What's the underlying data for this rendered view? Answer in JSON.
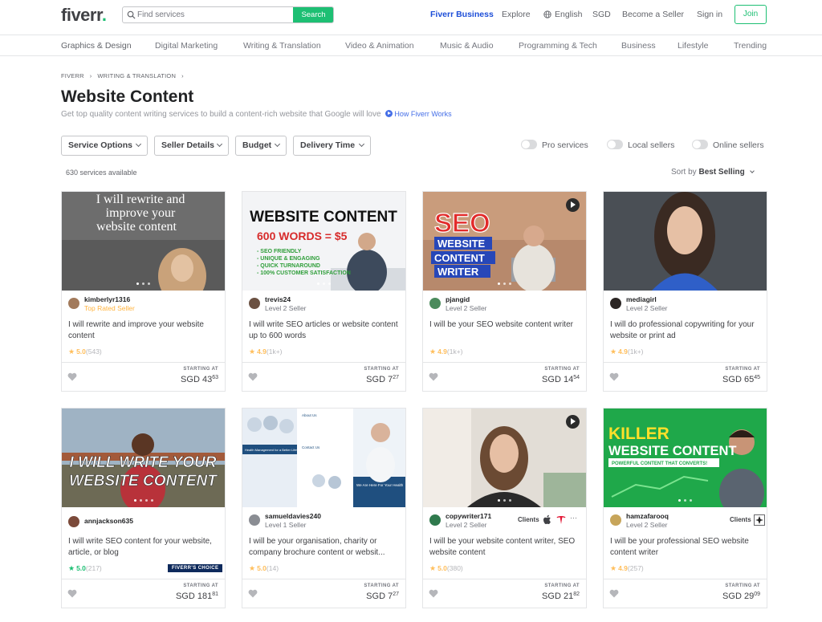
{
  "header": {
    "logo": "fiverr",
    "logo_dot": ".",
    "search_placeholder": "Find services",
    "search_button": "Search",
    "nav": {
      "fiverr_business": "Fiverr Business",
      "explore": "Explore",
      "language": "English",
      "currency": "SGD",
      "become_seller": "Become a Seller",
      "sign_in": "Sign in",
      "join": "Join"
    },
    "brand_color": "#1dbf73"
  },
  "categories": [
    "Graphics & Design",
    "Digital Marketing",
    "Writing & Translation",
    "Video & Animation",
    "Music & Audio",
    "Programming & Tech",
    "Business",
    "Lifestyle",
    "Trending"
  ],
  "breadcrumb": [
    "FIVERR",
    "WRITING & TRANSLATION"
  ],
  "page": {
    "title": "Website Content",
    "subtitle": "Get top quality content writing services to build a content-rich website that Google will love",
    "how_link": "How Fiverr Works"
  },
  "filters": [
    "Service Options",
    "Seller Details",
    "Budget",
    "Delivery Time"
  ],
  "toggles": [
    "Pro services",
    "Local sellers",
    "Online sellers"
  ],
  "results": {
    "count": "630 services available",
    "sort_label": "Sort by",
    "sort_value": "Best Selling"
  },
  "gigs": [
    {
      "seller": "kimberlyr1316",
      "level": "Top Rated Seller",
      "title": "I will rewrite and improve your website content",
      "rating": "5.0",
      "reviews": "(543)",
      "starting": "STARTING AT",
      "currency": "SGD",
      "price_main": "43",
      "price_cents": "63",
      "thumb_text": [
        "I will rewrite and",
        "improve your",
        "website content"
      ]
    },
    {
      "seller": "trevis24",
      "level": "Level 2 Seller",
      "title": "I will write SEO articles or website content up to 600 words",
      "rating": "4.9",
      "reviews": "(1k+)",
      "starting": "STARTING AT",
      "currency": "SGD",
      "price_main": "7",
      "price_cents": "27",
      "thumb_text": [
        "WEBSITE CONTENT",
        "600 WORDS = $5",
        "- SEO FRIENDLY",
        "- UNIQUE & ENGAGING",
        "- QUICK TURNAROUND",
        "- 100% CUSTOMER SATISFACTION"
      ]
    },
    {
      "seller": "pjangid",
      "level": "Level 2 Seller",
      "title": "I will be your SEO website content writer",
      "rating": "4.9",
      "reviews": "(1k+)",
      "starting": "STARTING AT",
      "currency": "SGD",
      "price_main": "14",
      "price_cents": "54",
      "thumb_text": [
        "SEO",
        "WEBSITE",
        "CONTENT",
        "WRITER"
      ]
    },
    {
      "seller": "mediagirl",
      "level": "Level 2 Seller",
      "title": "I will do professional copywriting for your website or print ad",
      "rating": "4.9",
      "reviews": "(1k+)",
      "starting": "STARTING AT",
      "currency": "SGD",
      "price_main": "65",
      "price_cents": "45"
    },
    {
      "seller": "annjackson635",
      "level": "",
      "title": "I will write SEO content for your website, article, or blog",
      "rating": "5.0",
      "reviews": "(217)",
      "badge": "FIVERR'S CHOICE",
      "starting": "STARTING AT",
      "currency": "SGD",
      "price_main": "181",
      "price_cents": "81",
      "thumb_text": [
        "I WILL WRITE YOUR",
        "WEBSITE CONTENT"
      ]
    },
    {
      "seller": "samueldavies240",
      "level": "Level 1 Seller",
      "title": "I will be your organisation, charity or company brochure content or websit...",
      "rating": "5.0",
      "reviews": "(14)",
      "starting": "STARTING AT",
      "currency": "SGD",
      "price_main": "7",
      "price_cents": "27",
      "thumb_text": [
        "About Us",
        "Health Management for a Better Lifetime",
        "Contact Us",
        "We Are Here For Your Health"
      ]
    },
    {
      "seller": "copywriter171",
      "level": "Level 2 Seller",
      "clients": "Clients",
      "title": "I will be your website content writer, SEO website content",
      "rating": "5.0",
      "reviews": "(380)",
      "starting": "STARTING AT",
      "currency": "SGD",
      "price_main": "21",
      "price_cents": "82"
    },
    {
      "seller": "hamzafarooq",
      "level": "Level 2 Seller",
      "clients": "Clients",
      "title": "I will be your professional SEO website content writer",
      "rating": "4.9",
      "reviews": "(257)",
      "starting": "STARTING AT",
      "currency": "SGD",
      "price_main": "29",
      "price_cents": "09",
      "thumb_text": [
        "KILLER",
        "WEBSITE CONTENT",
        "POWERFUL CONTENT THAT CONVERTS!"
      ]
    }
  ]
}
